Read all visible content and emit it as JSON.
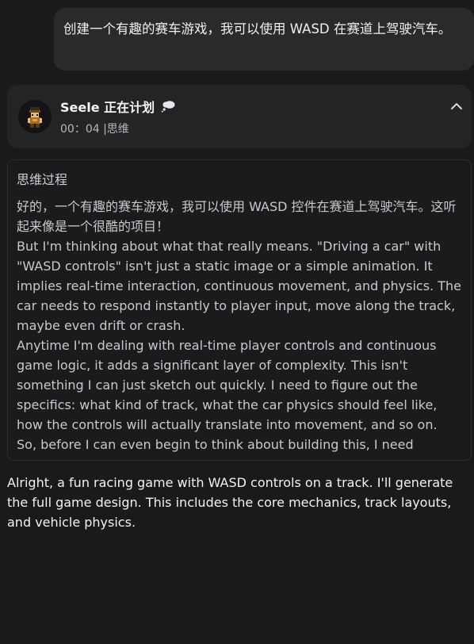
{
  "user_message": {
    "text": "创建一个有趣的赛车游戏，我可以使用 WASD 在赛道上驾驶汽车。"
  },
  "agent": {
    "title": "Seele 正在计划",
    "status_time": "00：04 |思维",
    "avatar_icon": "pixel-character-avatar",
    "status_icon": "thought-bubble-icon",
    "collapse_icon": "chevron-up-icon"
  },
  "thinking": {
    "title": "思维过程",
    "paragraphs": [
      "好的，一个有趣的赛车游戏，我可以使用 WASD 控件在赛道上驾驶汽车。这听起来像是一个很酷的项目！",
      "But I'm thinking about what that really means. \"Driving a car\" with \"WASD controls\" isn't just a static image or a simple animation. It implies real-time interaction, continuous movement, and physics. The car needs to respond instantly to player input, move along the track, maybe even drift or crash.",
      "Anytime I'm dealing with real-time player controls and continuous game logic, it adds a significant layer of complexity. This isn't something I can just sketch out quickly. I need to figure out the specifics: what kind of track, what the car physics should feel like, how the controls will actually translate into movement, and so on.",
      "So, before I can even begin to think about building this, I need"
    ]
  },
  "response": {
    "text": "Alright, a fun racing game with WASD controls on a track. I'll generate the full game design. This includes the core mechanics, track layouts, and vehicle physics."
  },
  "colors": {
    "background": "#1a1a1c",
    "bubble": "#2a2a2d",
    "card": "#242426",
    "thinking_border": "#2e2e31"
  }
}
